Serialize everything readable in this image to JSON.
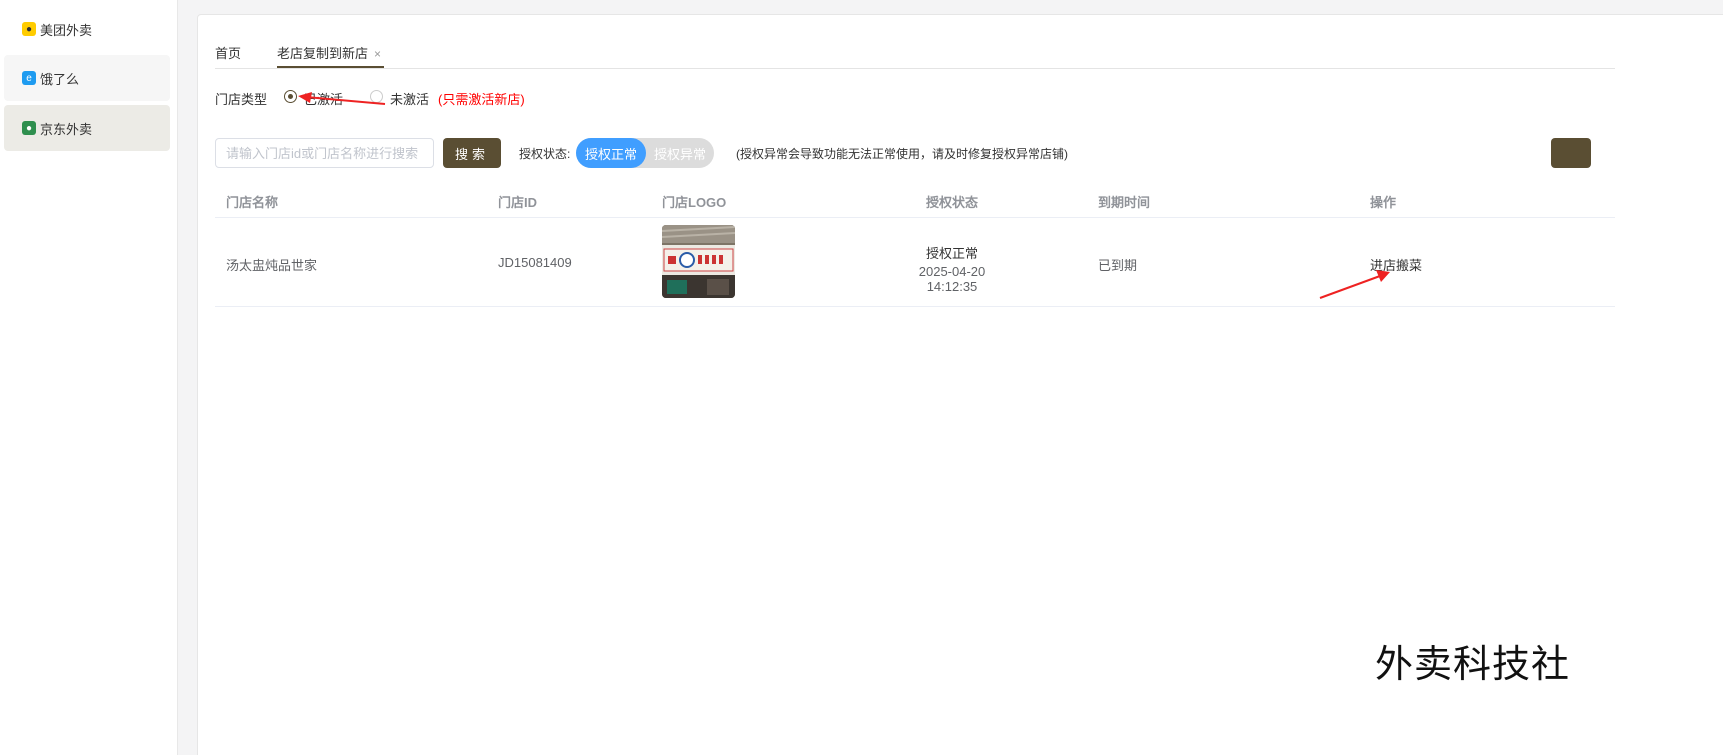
{
  "sidebar": {
    "items": [
      {
        "label": "美团外卖",
        "icon": "meituan-icon"
      },
      {
        "label": "饿了么",
        "icon": "eleme-icon"
      },
      {
        "label": "京东外卖",
        "icon": "jd-icon"
      }
    ]
  },
  "tabs": [
    {
      "label": "首页"
    },
    {
      "label": "老店复制到新店",
      "close": "×"
    }
  ],
  "store_type": {
    "label": "门店类型",
    "options": [
      {
        "label": "已激活",
        "selected": true
      },
      {
        "label": "未激活",
        "selected": false
      }
    ],
    "hint": "(只需激活新店)"
  },
  "search": {
    "placeholder": "请输入门店id或门店名称进行搜索",
    "button": "搜索"
  },
  "auth_filter": {
    "label": "授权状态:",
    "on": "授权正常",
    "off": "授权异常",
    "note": "(授权异常会导致功能无法正常使用，请及时修复授权异常店铺)"
  },
  "table": {
    "headers": [
      "门店名称",
      "门店ID",
      "门店LOGO",
      "授权状态",
      "到期时间",
      "操作"
    ],
    "rows": [
      {
        "name": "汤太盅炖品世家",
        "id": "JD15081409",
        "auth_status": "授权正常",
        "auth_time": "2025-04-20 14:12:35",
        "expire": "已到期",
        "action": "进店搬菜"
      }
    ]
  },
  "watermark": "外卖科技社",
  "colors": {
    "brand": "#5a4e33",
    "toggle_on": "#409eff",
    "hint_red": "#ff0000",
    "annotation_arrow": "#ee2222"
  }
}
